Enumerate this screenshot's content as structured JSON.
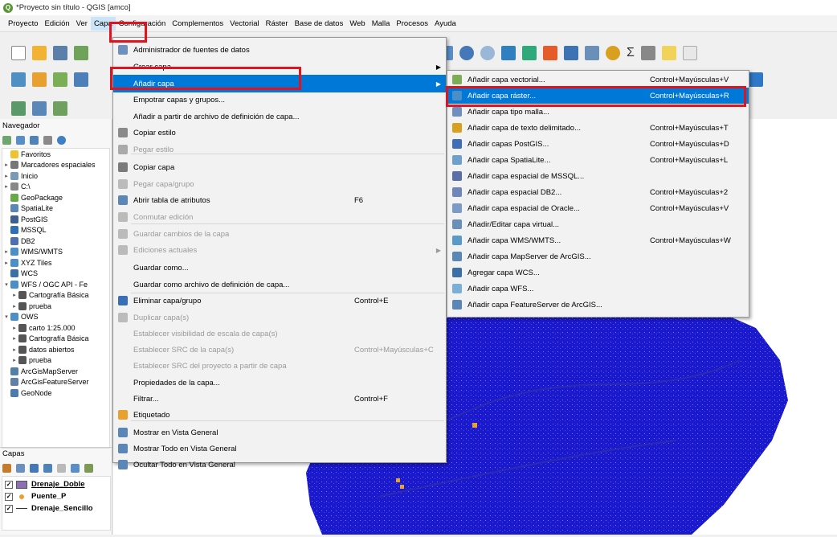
{
  "window": {
    "title": "*Proyecto sin título - QGIS [amco]"
  },
  "menubar": [
    "Proyecto",
    "Edición",
    "Ver",
    "Capa",
    "Configuración",
    "Complementos",
    "Vectorial",
    "Ráster",
    "Base de datos",
    "Web",
    "Malla",
    "Procesos",
    "Ayuda"
  ],
  "toolbar": {
    "sigma": "Σ"
  },
  "browser": {
    "title": "Navegador",
    "items": [
      {
        "label": "Favoritos",
        "expand": ""
      },
      {
        "label": "Marcadores espaciales",
        "expand": "▸"
      },
      {
        "label": "Inicio",
        "expand": "▸"
      },
      {
        "label": "C:\\",
        "expand": "▸"
      },
      {
        "label": "GeoPackage",
        "expand": ""
      },
      {
        "label": "SpatiaLite",
        "expand": ""
      },
      {
        "label": "PostGIS",
        "expand": ""
      },
      {
        "label": "MSSQL",
        "expand": ""
      },
      {
        "label": "DB2",
        "expand": ""
      },
      {
        "label": "WMS/WMTS",
        "expand": "▸"
      },
      {
        "label": "XYZ Tiles",
        "expand": "▸"
      },
      {
        "label": "WCS",
        "expand": ""
      },
      {
        "label": "WFS / OGC API - Fe",
        "expand": "▾"
      },
      {
        "label": "Cartografía Básica",
        "expand": "▸",
        "indent": 1
      },
      {
        "label": "prueba",
        "expand": "▸",
        "indent": 1
      },
      {
        "label": "OWS",
        "expand": "▾"
      },
      {
        "label": "carto 1:25.000",
        "expand": "▸",
        "indent": 1
      },
      {
        "label": "Cartografía Básica",
        "expand": "▸",
        "indent": 1
      },
      {
        "label": "datos abiertos",
        "expand": "▸",
        "indent": 1
      },
      {
        "label": "prueba",
        "expand": "▸",
        "indent": 1
      },
      {
        "label": "ArcGisMapServer",
        "expand": ""
      },
      {
        "label": "ArcGisFeatureServer",
        "expand": ""
      },
      {
        "label": "GeoNode",
        "expand": ""
      }
    ]
  },
  "layers_panel": {
    "title": "Capas",
    "items": [
      {
        "label": "Drenaje_Doble",
        "checked": "✓"
      },
      {
        "label": "Puente_P",
        "checked": "✓"
      },
      {
        "label": "Drenaje_Sencillo",
        "checked": "✓"
      }
    ]
  },
  "capa_menu": {
    "items": [
      {
        "label": "Administrador de fuentes de datos",
        "shortcut": ""
      },
      {
        "label": "Crear capa",
        "shortcut": "",
        "sub": "▶"
      },
      {
        "label": "Añadir capa",
        "shortcut": "",
        "sub": "▶"
      },
      {
        "label": "Empotrar capas y grupos...",
        "shortcut": ""
      },
      {
        "label": "Añadir a partir de archivo de definición de capa...",
        "shortcut": ""
      },
      {
        "label": "Copiar estilo",
        "shortcut": ""
      },
      {
        "label": "Pegar estilo",
        "shortcut": ""
      },
      {
        "label": "Copiar capa",
        "shortcut": ""
      },
      {
        "label": "Pegar capa/grupo",
        "shortcut": ""
      },
      {
        "label": "Abrir tabla de atributos",
        "shortcut": "F6"
      },
      {
        "label": "Conmutar edición",
        "shortcut": ""
      },
      {
        "label": "Guardar cambios de la capa",
        "shortcut": ""
      },
      {
        "label": "Ediciones actuales",
        "shortcut": "",
        "sub": "▶"
      },
      {
        "label": "Guardar como...",
        "shortcut": ""
      },
      {
        "label": "Guardar como archivo de definición de capa...",
        "shortcut": ""
      },
      {
        "label": "Eliminar capa/grupo",
        "shortcut": "Control+E"
      },
      {
        "label": "Duplicar capa(s)",
        "shortcut": ""
      },
      {
        "label": "Establecer visibilidad de escala de capa(s)",
        "shortcut": ""
      },
      {
        "label": "Establecer SRC de la capa(s)",
        "shortcut": "Control+Mayúsculas+C"
      },
      {
        "label": "Establecer SRC del proyecto a partir de capa",
        "shortcut": ""
      },
      {
        "label": "Propiedades de la capa...",
        "shortcut": ""
      },
      {
        "label": "Filtrar...",
        "shortcut": "Control+F"
      },
      {
        "label": "Etiquetado",
        "shortcut": ""
      },
      {
        "label": "Mostrar en Vista General",
        "shortcut": ""
      },
      {
        "label": "Mostrar Todo en Vista General",
        "shortcut": ""
      },
      {
        "label": "Ocultar Todo en Vista General",
        "shortcut": ""
      }
    ]
  },
  "submenu": {
    "items": [
      {
        "label": "Añadir capa vectorial...",
        "shortcut": "Control+Mayúsculas+V"
      },
      {
        "label": "Añadir capa ráster...",
        "shortcut": "Control+Mayúsculas+R"
      },
      {
        "label": "Añadir capa tipo malla...",
        "shortcut": ""
      },
      {
        "label": "Añadir capa de texto delimitado...",
        "shortcut": "Control+Mayúsculas+T"
      },
      {
        "label": "Añadir capas PostGIS...",
        "shortcut": "Control+Mayúsculas+D"
      },
      {
        "label": "Añadir capa SpatiaLite...",
        "shortcut": "Control+Mayúsculas+L"
      },
      {
        "label": "Añadir capa espacial de MSSQL...",
        "shortcut": ""
      },
      {
        "label": "Añadir capa espacial DB2...",
        "shortcut": "Control+Mayúsculas+2"
      },
      {
        "label": "Añadir capa espacial de Oracle...",
        "shortcut": "Control+Mayúsculas+V"
      },
      {
        "label": "Añadir/Editar capa virtual...",
        "shortcut": ""
      },
      {
        "label": "Añadir capa WMS/WMTS...",
        "shortcut": "Control+Mayúsculas+W"
      },
      {
        "label": "Añadir capa MapServer de ArcGIS...",
        "shortcut": ""
      },
      {
        "label": "Agregar capa WCS...",
        "shortcut": ""
      },
      {
        "label": "Añadir capa WFS...",
        "shortcut": ""
      },
      {
        "label": "Añadir capa FeatureServer de ArcGIS...",
        "shortcut": ""
      }
    ]
  },
  "colors": {
    "menu_highlight": "#0078d7",
    "map_fill": "#1a1acc",
    "callout": "#e0141e"
  }
}
